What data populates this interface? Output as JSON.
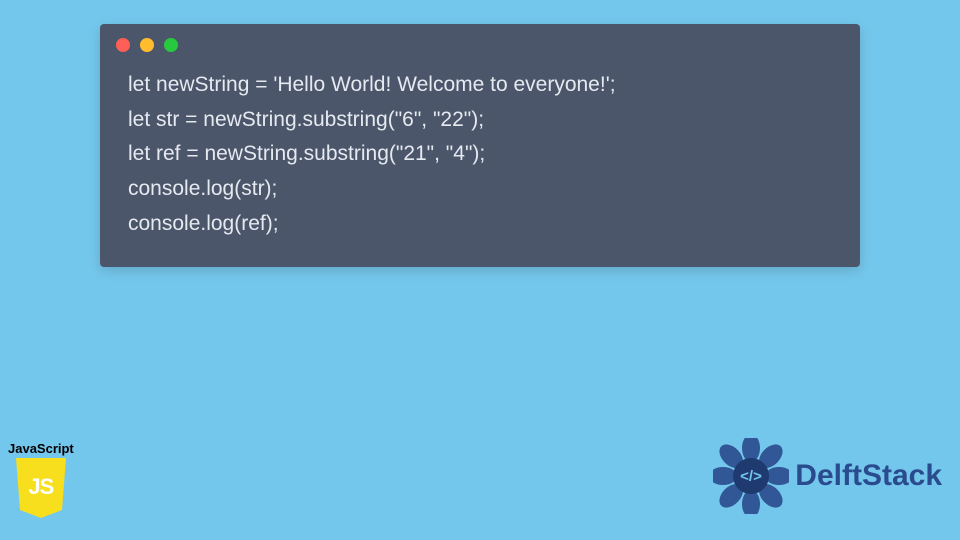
{
  "code": {
    "lines": [
      "let newString = 'Hello World! Welcome to everyone!';",
      "let str = newString.substring(\"6\", \"22\");",
      "let ref = newString.substring(\"21\", \"4\");",
      "console.log(str);",
      "console.log(ref);"
    ]
  },
  "jsBadge": {
    "label": "JavaScript",
    "monogram": "JS"
  },
  "brand": {
    "name": "DelftStack",
    "glyph": "</>"
  },
  "colors": {
    "pageBg": "#74c7ec",
    "windowBg": "#4c566a",
    "codeText": "#e5e9f0",
    "jsYellow": "#f7df1e",
    "brandBlue": "#2a4b8d"
  }
}
